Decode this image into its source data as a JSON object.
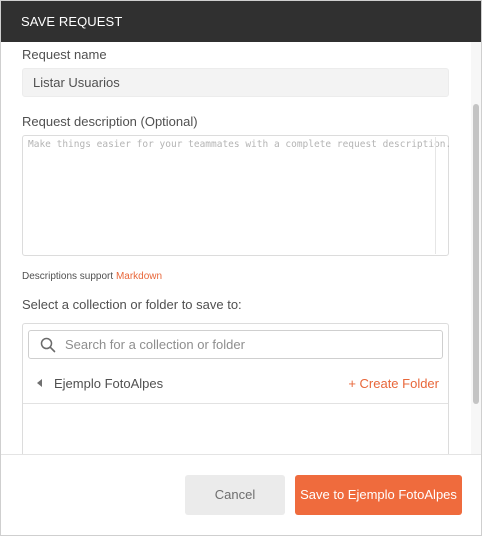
{
  "dialog": {
    "title": "SAVE REQUEST"
  },
  "request_name": {
    "label": "Request name",
    "value": "Listar Usuarios"
  },
  "request_description": {
    "label": "Request description (Optional)",
    "placeholder": "Make things easier for your teammates with a complete request description."
  },
  "markdown_note": {
    "prefix": "Descriptions support ",
    "link": "Markdown"
  },
  "collection": {
    "label": "Select a collection or folder to save to:",
    "search_placeholder": "Search for a collection or folder",
    "items": [
      {
        "name": "Ejemplo FotoAlpes",
        "action": "+ Create Folder"
      }
    ]
  },
  "footer": {
    "cancel_label": "Cancel",
    "save_label": "Save to Ejemplo FotoAlpes"
  },
  "colors": {
    "header_bg": "#303030",
    "accent": "#ef6b3d",
    "link": "#e8673a"
  },
  "icons": {
    "search": "search-icon",
    "caret": "caret-left-icon"
  }
}
